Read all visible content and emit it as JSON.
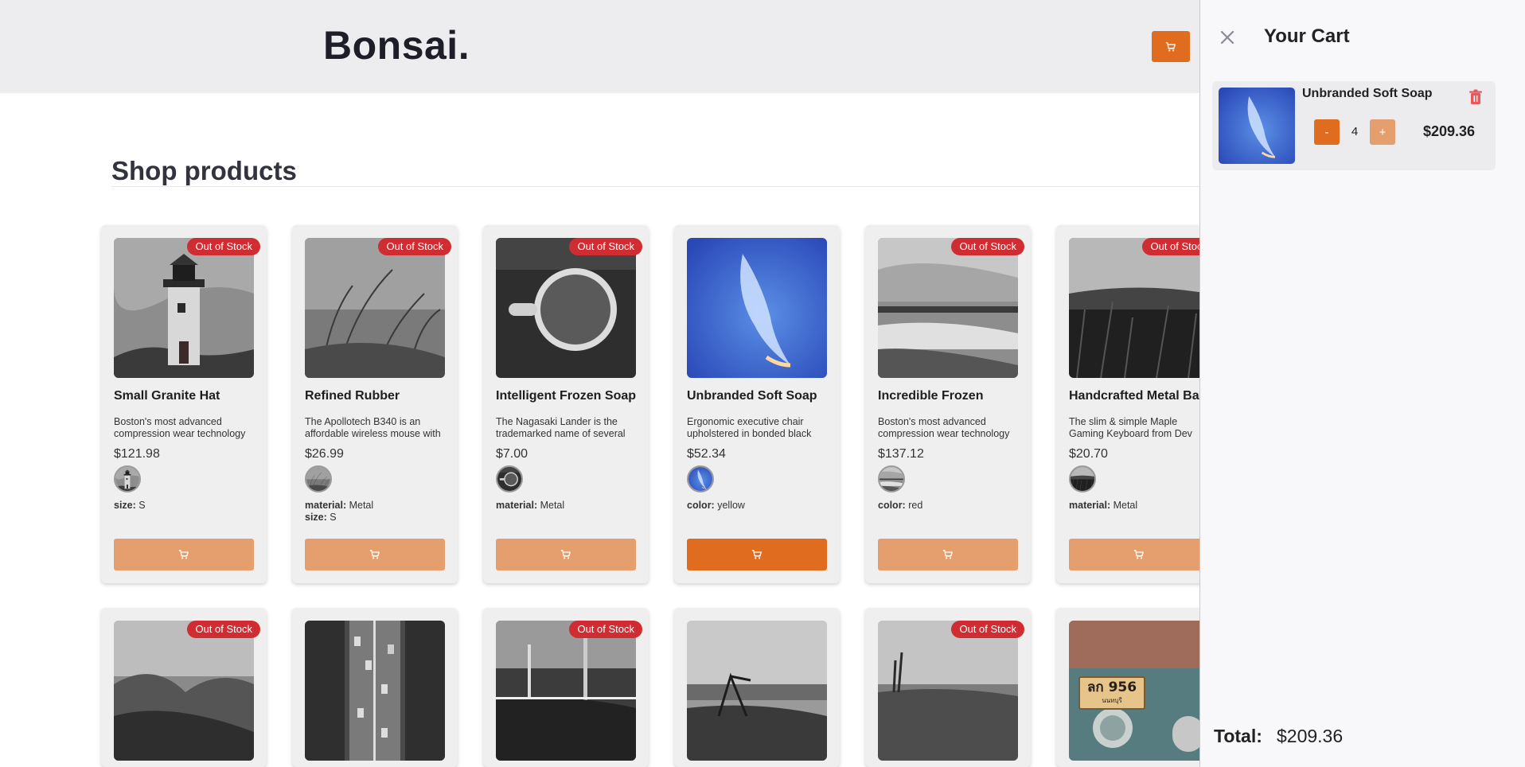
{
  "brand": {
    "logo": "Bonsai."
  },
  "section": {
    "title": "Shop products"
  },
  "badge_text": "Out of Stock",
  "products": [
    {
      "name": "Small Granite Hat",
      "desc": "Boston's most advanced compression wear technology",
      "price": "$121.98",
      "out_of_stock": true,
      "attrs": [
        {
          "k": "size:",
          "v": "S"
        }
      ],
      "image": "lighthouse"
    },
    {
      "name": "Refined Rubber",
      "desc": "The Apollotech B340 is an affordable wireless mouse with",
      "price": "$26.99",
      "out_of_stock": true,
      "attrs": [
        {
          "k": "material:",
          "v": "Metal"
        },
        {
          "k": "size:",
          "v": "S"
        }
      ],
      "image": "grass"
    },
    {
      "name": "Intelligent Frozen Soap",
      "desc": "The Nagasaki Lander is the trademarked name of several",
      "price": "$7.00",
      "out_of_stock": true,
      "attrs": [
        {
          "k": "material:",
          "v": "Metal"
        }
      ],
      "image": "coffee"
    },
    {
      "name": "Unbranded Soft Soap",
      "desc": "Ergonomic executive chair upholstered in bonded black",
      "price": "$52.34",
      "out_of_stock": false,
      "attrs": [
        {
          "k": "color:",
          "v": "yellow"
        }
      ],
      "image": "sky"
    },
    {
      "name": "Incredible Frozen",
      "desc": "Boston's most advanced compression wear technology",
      "price": "$137.12",
      "out_of_stock": true,
      "attrs": [
        {
          "k": "color:",
          "v": "red"
        }
      ],
      "image": "beach"
    },
    {
      "name": "Handcrafted Metal Ba",
      "desc": "The slim & simple Maple Gaming Keyboard from Dev",
      "price": "$20.70",
      "out_of_stock": true,
      "attrs": [
        {
          "k": "material:",
          "v": "Metal"
        }
      ],
      "image": "field"
    }
  ],
  "row2_out_of_stock": [
    true,
    false,
    true,
    false,
    true,
    false
  ],
  "row2_images": [
    "valley",
    "road",
    "forest",
    "swing",
    "meadow",
    "car"
  ],
  "plate": {
    "text": "ลก 956",
    "sub": "นนทบุรี"
  },
  "cart": {
    "title": "Your Cart",
    "items": [
      {
        "name": "Unbranded Soft Soap",
        "qty": "4",
        "price": "$209.36",
        "minus": "-",
        "plus": "+"
      }
    ],
    "total_label": "Total:",
    "total_value": "$209.36"
  },
  "colors": {
    "accent": "#e06c20",
    "accent_light": "#e59f6e",
    "badge": "#d12c32",
    "header_bg": "#ededf0"
  },
  "icons": {
    "cart": "cart-icon",
    "close": "close-icon",
    "trash": "trash-icon"
  }
}
